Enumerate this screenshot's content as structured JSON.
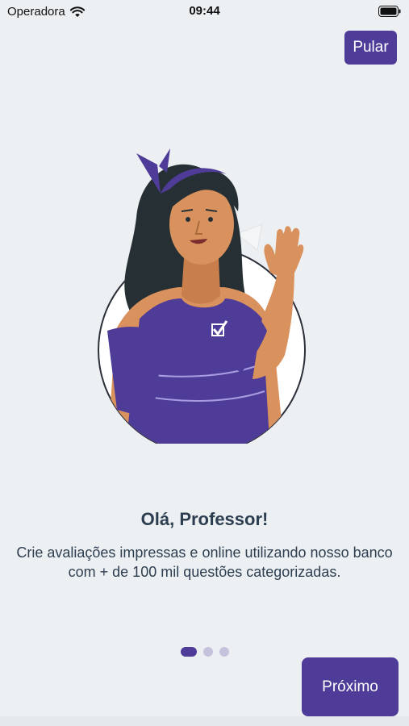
{
  "status_bar": {
    "carrier": "Operadora",
    "time": "09:44"
  },
  "header": {
    "skip_label": "Pular"
  },
  "onboarding": {
    "title": "Olá, Professor!",
    "description": "Crie avaliações impressas e online utilizando nosso banco com + de 100 mil questões categorizadas.",
    "page_count": 3,
    "active_page": 1
  },
  "footer": {
    "next_label": "Próximo"
  },
  "colors": {
    "accent": "#4e3c98",
    "background": "#edf0f2",
    "text": "#2c3e50",
    "dot_inactive": "#c5c2dc",
    "skin": "#d9925d",
    "hair": "#263034"
  },
  "icons": {
    "wifi": "wifi-icon",
    "battery": "battery-icon",
    "illustration": "teacher-waving-illustration"
  }
}
